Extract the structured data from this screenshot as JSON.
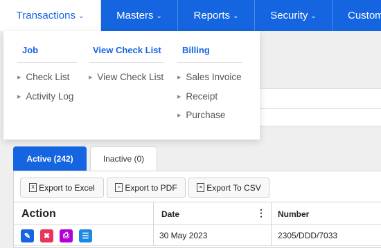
{
  "nav": {
    "items": [
      {
        "label": "Transactions",
        "active": true
      },
      {
        "label": "Masters",
        "active": false
      },
      {
        "label": "Reports",
        "active": false
      },
      {
        "label": "Security",
        "active": false
      },
      {
        "label": "Custom",
        "active": false
      }
    ],
    "chevron": "chevron-down-icon"
  },
  "dropdown": {
    "columns": [
      {
        "title": "Job",
        "links": [
          "Check List",
          "Activity Log"
        ]
      },
      {
        "title": "View Check List",
        "links": [
          "View Check List"
        ]
      },
      {
        "title": "Billing",
        "links": [
          "Sales Invoice",
          "Receipt",
          "Purchase"
        ]
      }
    ]
  },
  "tabs": {
    "active_label": "Active (242)",
    "inactive_label": "Inactive (0)"
  },
  "toolbar": {
    "excel_label": "Export to Excel",
    "pdf_label": "Export to PDF",
    "csv_label": "Export To CSV"
  },
  "table": {
    "headers": {
      "action": "Action",
      "date": "Date",
      "number": "Number"
    },
    "rows": [
      {
        "date": "30 May 2023",
        "number": "2305/DDD/7033"
      }
    ],
    "action_icons": [
      {
        "name": "edit-icon",
        "color": "#1565e0",
        "glyph": "✎"
      },
      {
        "name": "delete-icon",
        "color": "#e8335b",
        "glyph": "✖"
      },
      {
        "name": "print-icon",
        "color": "#b200d6",
        "glyph": "⎙"
      },
      {
        "name": "list-icon",
        "color": "#1e88e5",
        "glyph": "☰"
      }
    ]
  },
  "colors": {
    "primary": "#1565e0",
    "delete": "#e8335b",
    "print": "#b200d6"
  }
}
